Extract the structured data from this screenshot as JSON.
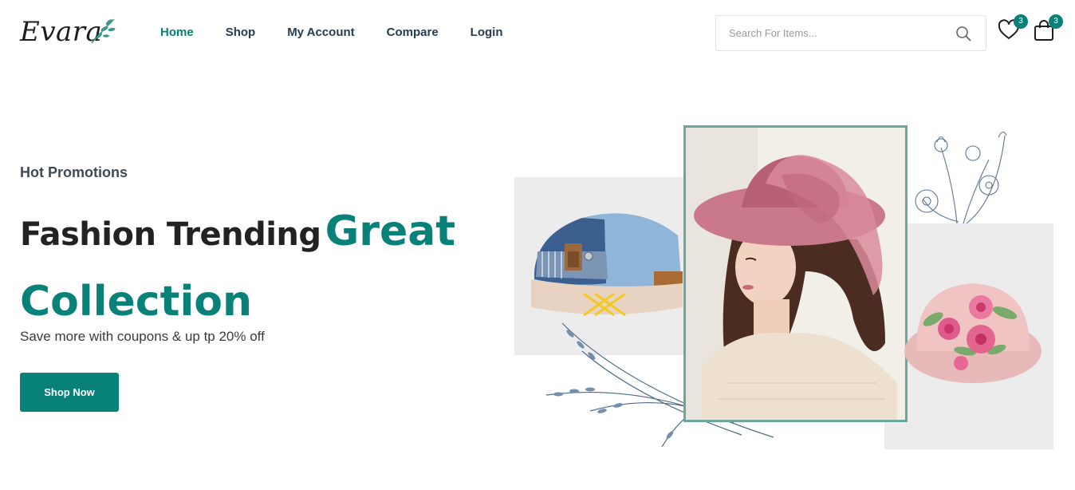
{
  "brand": {
    "name": "Evara"
  },
  "nav": {
    "items": [
      {
        "label": "Home",
        "active": true
      },
      {
        "label": "Shop",
        "active": false
      },
      {
        "label": "My Account",
        "active": false
      },
      {
        "label": "Compare",
        "active": false
      },
      {
        "label": "Login",
        "active": false
      }
    ]
  },
  "search": {
    "placeholder": "Search For Items...",
    "value": "",
    "icon": "search-icon"
  },
  "wishlist": {
    "icon": "heart-icon",
    "count": "3"
  },
  "cart": {
    "icon": "shopping-bag-icon",
    "count": "3"
  },
  "hero": {
    "subtitle": "Hot Promotions",
    "title_dark": "Fashion Trending",
    "title_green_1": "Great",
    "title_green_2": "Collection",
    "description": "Save more with coupons & up tp 20% off",
    "button_label": "Shop Now"
  },
  "colors": {
    "accent": "#088178",
    "text": "#253d4e",
    "panel": "#ececec",
    "frame": "#6ea59d"
  }
}
